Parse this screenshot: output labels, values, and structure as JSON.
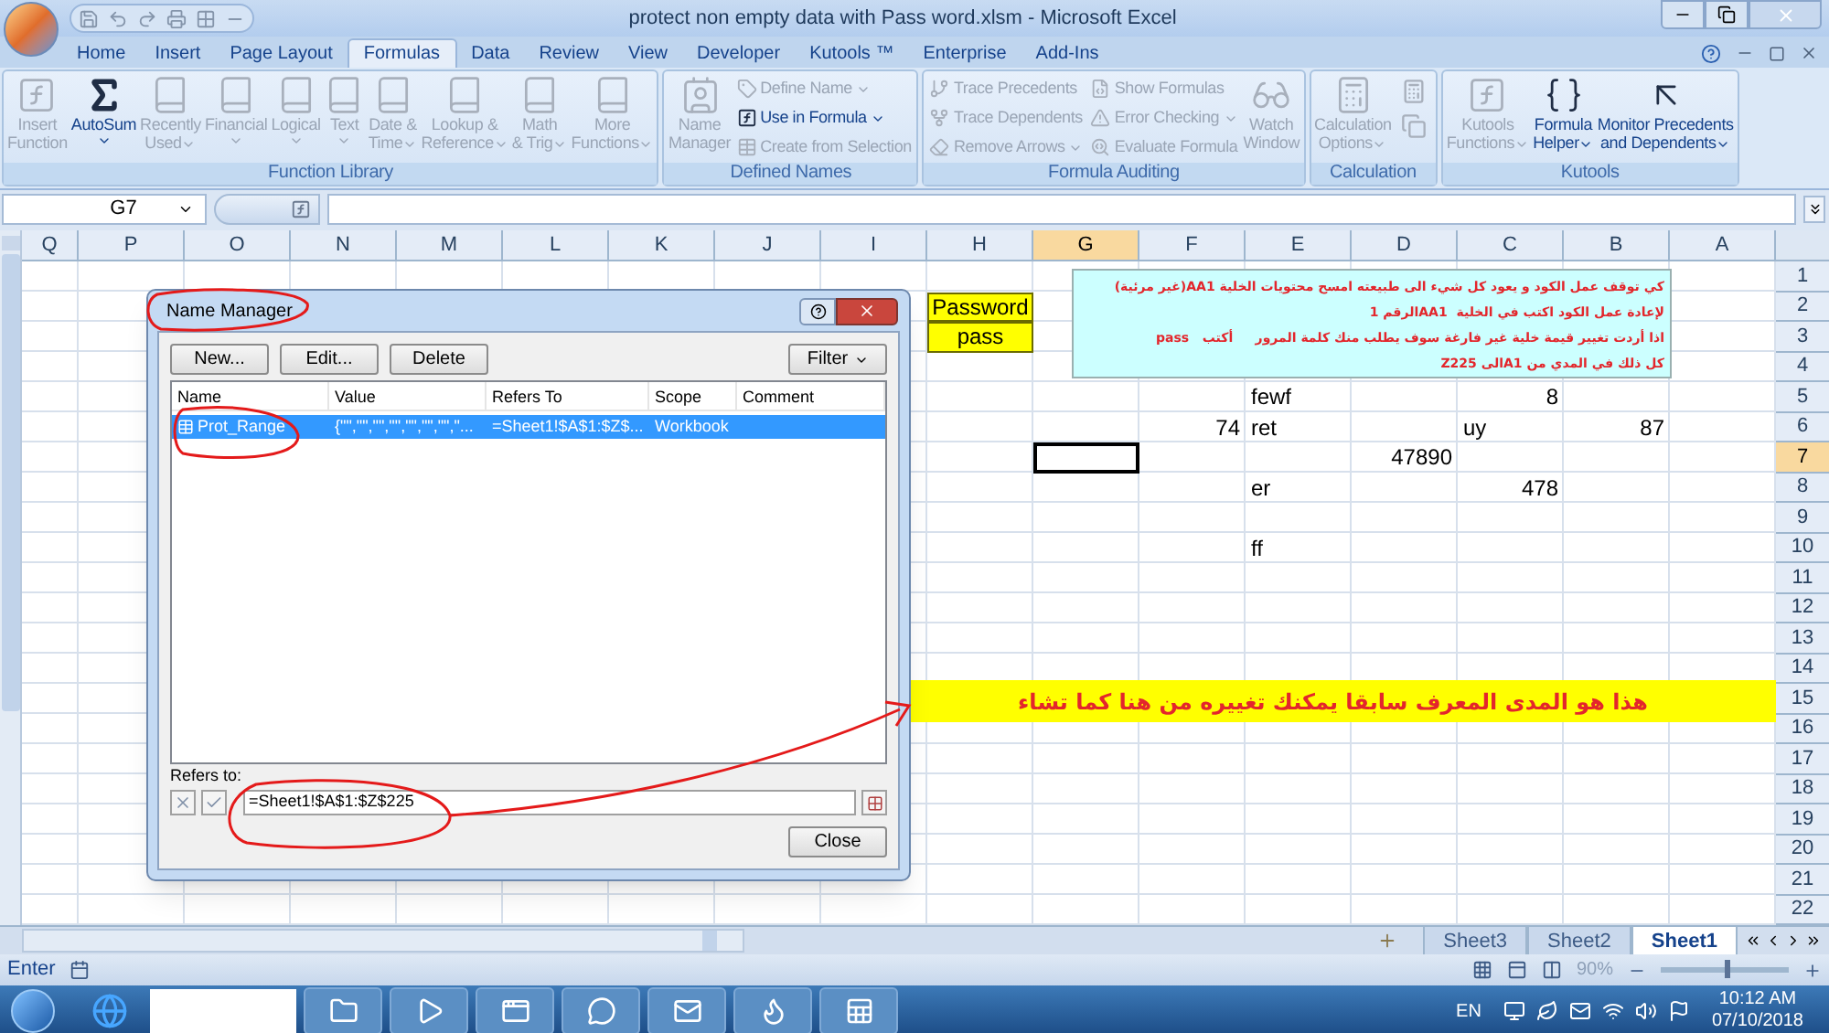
{
  "window": {
    "title": "protect non empty data with Pass word.xlsm - Microsoft Excel"
  },
  "ribbon_tabs": [
    {
      "label": "Home",
      "selected": false
    },
    {
      "label": "Insert",
      "selected": false
    },
    {
      "label": "Page Layout",
      "selected": false
    },
    {
      "label": "Formulas",
      "selected": true
    },
    {
      "label": "Data",
      "selected": false
    },
    {
      "label": "Review",
      "selected": false
    },
    {
      "label": "View",
      "selected": false
    },
    {
      "label": "Developer",
      "selected": false
    },
    {
      "label": "Kutools ™",
      "selected": false
    },
    {
      "label": "Enterprise",
      "selected": false
    },
    {
      "label": "Add-Ins",
      "selected": false
    }
  ],
  "ribbon_groups": [
    {
      "title": "Function Library",
      "items": [
        {
          "kind": "large",
          "lines": [
            "Insert",
            "Function"
          ],
          "disabled": true,
          "dropdown": false
        },
        {
          "kind": "large",
          "lines": [
            "AutoSum"
          ],
          "disabled": false,
          "dropdown": true
        },
        {
          "kind": "large",
          "lines": [
            "Recently",
            "Used"
          ],
          "disabled": true,
          "dropdown": true
        },
        {
          "kind": "large",
          "lines": [
            "Financial"
          ],
          "disabled": true,
          "dropdown": true
        },
        {
          "kind": "large",
          "lines": [
            "Logical"
          ],
          "disabled": true,
          "dropdown": true
        },
        {
          "kind": "large",
          "lines": [
            "Text"
          ],
          "disabled": true,
          "dropdown": true
        },
        {
          "kind": "large",
          "lines": [
            "Date &",
            "Time"
          ],
          "disabled": true,
          "dropdown": true
        },
        {
          "kind": "large",
          "lines": [
            "Lookup &",
            "Reference"
          ],
          "disabled": true,
          "dropdown": true
        },
        {
          "kind": "large",
          "lines": [
            "Math",
            "& Trig"
          ],
          "disabled": true,
          "dropdown": true
        },
        {
          "kind": "large",
          "lines": [
            "More",
            "Functions"
          ],
          "disabled": true,
          "dropdown": true
        }
      ]
    },
    {
      "title": "Defined Names",
      "items": [
        {
          "kind": "large",
          "lines": [
            "Name",
            "Manager"
          ],
          "disabled": true,
          "dropdown": false
        },
        {
          "kind": "small",
          "lines": [
            "Define Name"
          ],
          "disabled": true,
          "dropdown": true
        },
        {
          "kind": "small",
          "lines": [
            "Use in Formula"
          ],
          "disabled": false,
          "dropdown": true
        },
        {
          "kind": "small",
          "lines": [
            "Create from Selection"
          ],
          "disabled": true,
          "dropdown": false
        }
      ]
    },
    {
      "title": "Formula Auditing",
      "items": [
        {
          "kind": "small",
          "lines": [
            "Trace Precedents"
          ],
          "disabled": true,
          "dropdown": false
        },
        {
          "kind": "small",
          "lines": [
            "Trace Dependents"
          ],
          "disabled": true,
          "dropdown": false
        },
        {
          "kind": "small",
          "lines": [
            "Remove Arrows"
          ],
          "disabled": true,
          "dropdown": true
        },
        {
          "kind": "small",
          "lines": [
            "Show Formulas"
          ],
          "disabled": true,
          "dropdown": false
        },
        {
          "kind": "small",
          "lines": [
            "Error Checking"
          ],
          "disabled": true,
          "dropdown": true
        },
        {
          "kind": "small",
          "lines": [
            "Evaluate Formula"
          ],
          "disabled": true,
          "dropdown": false
        },
        {
          "kind": "large",
          "lines": [
            "Watch",
            "Window"
          ],
          "disabled": true,
          "dropdown": false
        }
      ]
    },
    {
      "title": "Calculation",
      "items": [
        {
          "kind": "large",
          "lines": [
            "Calculation",
            "Options"
          ],
          "disabled": true,
          "dropdown": true
        },
        {
          "kind": "icon",
          "disabled": true
        },
        {
          "kind": "icon",
          "disabled": true
        }
      ]
    },
    {
      "title": "Kutools",
      "items": [
        {
          "kind": "large",
          "lines": [
            "Kutools",
            "Functions"
          ],
          "disabled": true,
          "dropdown": true
        },
        {
          "kind": "large",
          "lines": [
            "Formula",
            "Helper"
          ],
          "disabled": false,
          "dropdown": true
        },
        {
          "kind": "large",
          "lines": [
            "Monitor Precedents",
            "and Dependents"
          ],
          "disabled": false,
          "dropdown": true
        }
      ]
    }
  ],
  "formula_bar": {
    "name_box": "G7"
  },
  "grid": {
    "columns": [
      {
        "label": "Q",
        "selected": false
      },
      {
        "label": "P",
        "selected": false
      },
      {
        "label": "O",
        "selected": false
      },
      {
        "label": "N",
        "selected": false
      },
      {
        "label": "M",
        "selected": false
      },
      {
        "label": "L",
        "selected": false
      },
      {
        "label": "K",
        "selected": false
      },
      {
        "label": "J",
        "selected": false
      },
      {
        "label": "I",
        "selected": false
      },
      {
        "label": "H",
        "selected": false
      },
      {
        "label": "G",
        "selected": true
      },
      {
        "label": "F",
        "selected": false
      },
      {
        "label": "E",
        "selected": false
      },
      {
        "label": "D",
        "selected": false
      },
      {
        "label": "C",
        "selected": false
      },
      {
        "label": "B",
        "selected": false
      },
      {
        "label": "A",
        "selected": false
      }
    ],
    "rows": [
      {
        "label": "1",
        "selected": false
      },
      {
        "label": "2",
        "selected": false,
        "cells": [
          null,
          null,
          null,
          null,
          null,
          null,
          null,
          null,
          null,
          {
            "text": "Password",
            "kind": "boxed"
          },
          null,
          null,
          null,
          null,
          null,
          null,
          null
        ]
      },
      {
        "label": "3",
        "selected": false,
        "cells": [
          null,
          null,
          null,
          null,
          null,
          null,
          null,
          null,
          null,
          {
            "text": "pass",
            "kind": "boxed"
          },
          null,
          null,
          null,
          null,
          null,
          null,
          null
        ]
      },
      {
        "label": "4",
        "selected": false
      },
      {
        "label": "5",
        "selected": false,
        "cells": [
          null,
          null,
          null,
          null,
          null,
          null,
          null,
          null,
          null,
          null,
          null,
          null,
          {
            "text": "fewf",
            "kind": "text"
          },
          null,
          {
            "text": "8",
            "kind": "number"
          },
          null,
          null
        ]
      },
      {
        "label": "6",
        "selected": false,
        "cells": [
          null,
          null,
          null,
          null,
          null,
          null,
          null,
          null,
          null,
          null,
          null,
          {
            "text": "74",
            "kind": "number"
          },
          {
            "text": "ret",
            "kind": "text"
          },
          null,
          {
            "text": "uy",
            "kind": "text"
          },
          {
            "text": "87",
            "kind": "number"
          },
          null
        ]
      },
      {
        "label": "7",
        "selected": true,
        "cells": [
          null,
          null,
          null,
          null,
          null,
          null,
          null,
          null,
          null,
          null,
          null,
          null,
          null,
          {
            "text": "47890",
            "kind": "number"
          },
          null,
          null,
          null
        ]
      },
      {
        "label": "8",
        "selected": false,
        "cells": [
          null,
          null,
          null,
          null,
          null,
          null,
          null,
          null,
          null,
          null,
          null,
          null,
          {
            "text": "er",
            "kind": "text"
          },
          null,
          {
            "text": "478",
            "kind": "number"
          },
          null,
          null
        ]
      },
      {
        "label": "9",
        "selected": false
      },
      {
        "label": "10",
        "selected": false,
        "cells": [
          null,
          null,
          null,
          null,
          null,
          null,
          null,
          null,
          null,
          null,
          null,
          null,
          {
            "text": "ff",
            "kind": "text"
          },
          null,
          null,
          null,
          null
        ]
      },
      {
        "label": "11",
        "selected": false
      },
      {
        "label": "12",
        "selected": false
      },
      {
        "label": "13",
        "selected": false
      },
      {
        "label": "14",
        "selected": false
      },
      {
        "label": "15",
        "selected": false
      },
      {
        "label": "16",
        "selected": false
      },
      {
        "label": "17",
        "selected": false
      },
      {
        "label": "18",
        "selected": false
      },
      {
        "label": "19",
        "selected": false
      },
      {
        "label": "20",
        "selected": false
      },
      {
        "label": "21",
        "selected": false
      },
      {
        "label": "22",
        "selected": false
      }
    ]
  },
  "note_box": {
    "lines": [
      "كي توقف عمل الكود و يعود كل شيء الى طبيعته امسح محتويات الخلية AA1(غير مرئية)",
      "لإعادة عمل الكود اكتب في الخلية  AA1الرقم 1",
      "اذا أردت تغيير قيمة خلية غير فارغة سوف يطلب منك كلمة المرور     أكتب   pass",
      "كل ذلك في المدي من A1الى Z225"
    ]
  },
  "banner": {
    "text": "هذا هو المدى المعرف سابقا يمكنك تغييره من هنا كما تشاء"
  },
  "dialog": {
    "title": "Name Manager",
    "buttons": [
      "New...",
      "Edit...",
      "Delete"
    ],
    "filter_button": "Filter",
    "columns": [
      "Name",
      "Value",
      "Refers To",
      "Scope",
      "Comment"
    ],
    "rows": [
      {
        "cells": [
          "Prot_Range",
          "{\"\",\"\",\"\",\"\",\"\",\"\",\"\",\"...",
          "=Sheet1!$A$1:$Z$...",
          "Workbook"
        ],
        "selected": true
      }
    ],
    "refers_label": "Refers to:",
    "refers_value": "=Sheet1!$A$1:$Z$225",
    "close_button": "Close"
  },
  "sheet_tabs": [
    {
      "label": "Sheet3",
      "selected": false
    },
    {
      "label": "Sheet2",
      "selected": false
    },
    {
      "label": "Sheet1",
      "selected": true
    }
  ],
  "status_bar": {
    "mode": "Enter",
    "zoom": "90%",
    "zoom_slider": {
      "level": 0.5
    }
  },
  "taskbar": {
    "language": "EN",
    "time": "10:12 AM",
    "date": "07/10/2018"
  }
}
